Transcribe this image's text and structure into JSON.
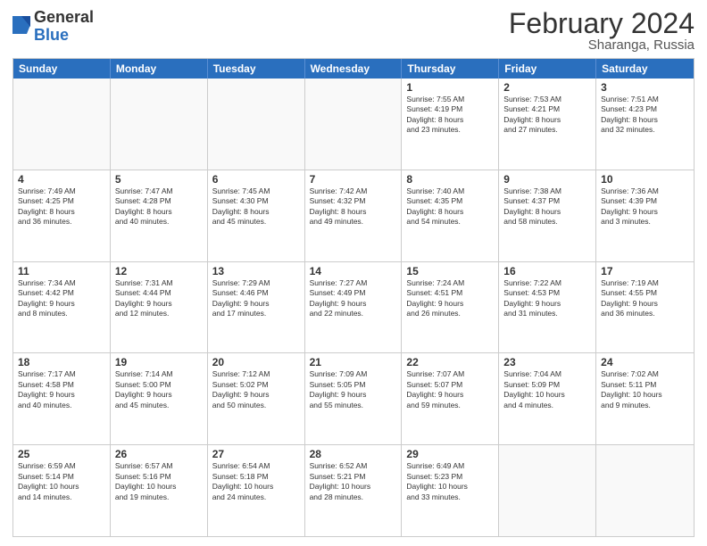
{
  "logo": {
    "general": "General",
    "blue": "Blue"
  },
  "title": "February 2024",
  "subtitle": "Sharanga, Russia",
  "header_days": [
    "Sunday",
    "Monday",
    "Tuesday",
    "Wednesday",
    "Thursday",
    "Friday",
    "Saturday"
  ],
  "rows": [
    [
      {
        "day": "",
        "lines": []
      },
      {
        "day": "",
        "lines": []
      },
      {
        "day": "",
        "lines": []
      },
      {
        "day": "",
        "lines": []
      },
      {
        "day": "1",
        "lines": [
          "Sunrise: 7:55 AM",
          "Sunset: 4:19 PM",
          "Daylight: 8 hours",
          "and 23 minutes."
        ]
      },
      {
        "day": "2",
        "lines": [
          "Sunrise: 7:53 AM",
          "Sunset: 4:21 PM",
          "Daylight: 8 hours",
          "and 27 minutes."
        ]
      },
      {
        "day": "3",
        "lines": [
          "Sunrise: 7:51 AM",
          "Sunset: 4:23 PM",
          "Daylight: 8 hours",
          "and 32 minutes."
        ]
      }
    ],
    [
      {
        "day": "4",
        "lines": [
          "Sunrise: 7:49 AM",
          "Sunset: 4:25 PM",
          "Daylight: 8 hours",
          "and 36 minutes."
        ]
      },
      {
        "day": "5",
        "lines": [
          "Sunrise: 7:47 AM",
          "Sunset: 4:28 PM",
          "Daylight: 8 hours",
          "and 40 minutes."
        ]
      },
      {
        "day": "6",
        "lines": [
          "Sunrise: 7:45 AM",
          "Sunset: 4:30 PM",
          "Daylight: 8 hours",
          "and 45 minutes."
        ]
      },
      {
        "day": "7",
        "lines": [
          "Sunrise: 7:42 AM",
          "Sunset: 4:32 PM",
          "Daylight: 8 hours",
          "and 49 minutes."
        ]
      },
      {
        "day": "8",
        "lines": [
          "Sunrise: 7:40 AM",
          "Sunset: 4:35 PM",
          "Daylight: 8 hours",
          "and 54 minutes."
        ]
      },
      {
        "day": "9",
        "lines": [
          "Sunrise: 7:38 AM",
          "Sunset: 4:37 PM",
          "Daylight: 8 hours",
          "and 58 minutes."
        ]
      },
      {
        "day": "10",
        "lines": [
          "Sunrise: 7:36 AM",
          "Sunset: 4:39 PM",
          "Daylight: 9 hours",
          "and 3 minutes."
        ]
      }
    ],
    [
      {
        "day": "11",
        "lines": [
          "Sunrise: 7:34 AM",
          "Sunset: 4:42 PM",
          "Daylight: 9 hours",
          "and 8 minutes."
        ]
      },
      {
        "day": "12",
        "lines": [
          "Sunrise: 7:31 AM",
          "Sunset: 4:44 PM",
          "Daylight: 9 hours",
          "and 12 minutes."
        ]
      },
      {
        "day": "13",
        "lines": [
          "Sunrise: 7:29 AM",
          "Sunset: 4:46 PM",
          "Daylight: 9 hours",
          "and 17 minutes."
        ]
      },
      {
        "day": "14",
        "lines": [
          "Sunrise: 7:27 AM",
          "Sunset: 4:49 PM",
          "Daylight: 9 hours",
          "and 22 minutes."
        ]
      },
      {
        "day": "15",
        "lines": [
          "Sunrise: 7:24 AM",
          "Sunset: 4:51 PM",
          "Daylight: 9 hours",
          "and 26 minutes."
        ]
      },
      {
        "day": "16",
        "lines": [
          "Sunrise: 7:22 AM",
          "Sunset: 4:53 PM",
          "Daylight: 9 hours",
          "and 31 minutes."
        ]
      },
      {
        "day": "17",
        "lines": [
          "Sunrise: 7:19 AM",
          "Sunset: 4:55 PM",
          "Daylight: 9 hours",
          "and 36 minutes."
        ]
      }
    ],
    [
      {
        "day": "18",
        "lines": [
          "Sunrise: 7:17 AM",
          "Sunset: 4:58 PM",
          "Daylight: 9 hours",
          "and 40 minutes."
        ]
      },
      {
        "day": "19",
        "lines": [
          "Sunrise: 7:14 AM",
          "Sunset: 5:00 PM",
          "Daylight: 9 hours",
          "and 45 minutes."
        ]
      },
      {
        "day": "20",
        "lines": [
          "Sunrise: 7:12 AM",
          "Sunset: 5:02 PM",
          "Daylight: 9 hours",
          "and 50 minutes."
        ]
      },
      {
        "day": "21",
        "lines": [
          "Sunrise: 7:09 AM",
          "Sunset: 5:05 PM",
          "Daylight: 9 hours",
          "and 55 minutes."
        ]
      },
      {
        "day": "22",
        "lines": [
          "Sunrise: 7:07 AM",
          "Sunset: 5:07 PM",
          "Daylight: 9 hours",
          "and 59 minutes."
        ]
      },
      {
        "day": "23",
        "lines": [
          "Sunrise: 7:04 AM",
          "Sunset: 5:09 PM",
          "Daylight: 10 hours",
          "and 4 minutes."
        ]
      },
      {
        "day": "24",
        "lines": [
          "Sunrise: 7:02 AM",
          "Sunset: 5:11 PM",
          "Daylight: 10 hours",
          "and 9 minutes."
        ]
      }
    ],
    [
      {
        "day": "25",
        "lines": [
          "Sunrise: 6:59 AM",
          "Sunset: 5:14 PM",
          "Daylight: 10 hours",
          "and 14 minutes."
        ]
      },
      {
        "day": "26",
        "lines": [
          "Sunrise: 6:57 AM",
          "Sunset: 5:16 PM",
          "Daylight: 10 hours",
          "and 19 minutes."
        ]
      },
      {
        "day": "27",
        "lines": [
          "Sunrise: 6:54 AM",
          "Sunset: 5:18 PM",
          "Daylight: 10 hours",
          "and 24 minutes."
        ]
      },
      {
        "day": "28",
        "lines": [
          "Sunrise: 6:52 AM",
          "Sunset: 5:21 PM",
          "Daylight: 10 hours",
          "and 28 minutes."
        ]
      },
      {
        "day": "29",
        "lines": [
          "Sunrise: 6:49 AM",
          "Sunset: 5:23 PM",
          "Daylight: 10 hours",
          "and 33 minutes."
        ]
      },
      {
        "day": "",
        "lines": []
      },
      {
        "day": "",
        "lines": []
      }
    ]
  ]
}
